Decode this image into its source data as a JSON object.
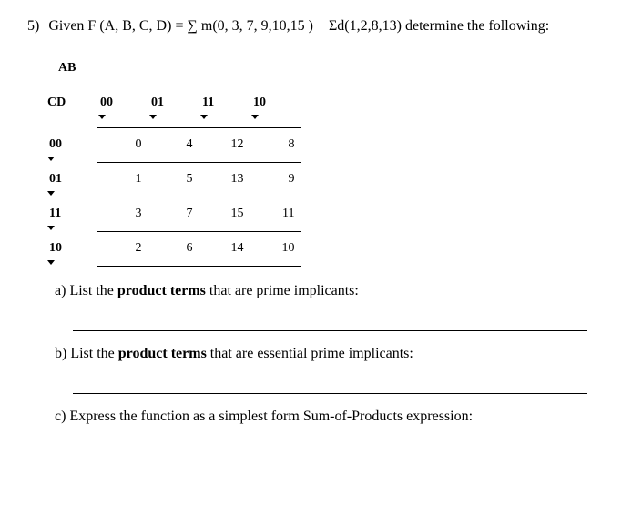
{
  "question": {
    "number": "5)",
    "text": "Given F (A, B, C, D) = ∑ m(0, 3, 7, 9,10,15 ) + Σd(1,2,8,13) determine the following:"
  },
  "kmap": {
    "ab_label": "AB",
    "cd_label": "CD",
    "col_headers": [
      "00",
      "01",
      "11",
      "10"
    ],
    "row_headers": [
      "00",
      "01",
      "11",
      "10"
    ],
    "rows": [
      [
        "0",
        "4",
        "12",
        "8"
      ],
      [
        "1",
        "5",
        "13",
        "9"
      ],
      [
        "3",
        "7",
        "15",
        "11"
      ],
      [
        "2",
        "6",
        "14",
        "10"
      ]
    ]
  },
  "parts": {
    "a": {
      "label": "a)",
      "text_pre": "List the ",
      "bold": "product terms",
      "text_post": " that are prime implicants:"
    },
    "b": {
      "label": "b)",
      "text_pre": "List the ",
      "bold": "product terms",
      "text_post": " that are essential prime implicants:"
    },
    "c": {
      "label": "c)",
      "text": "Express the function as a simplest form Sum-of-Products expression:"
    }
  }
}
